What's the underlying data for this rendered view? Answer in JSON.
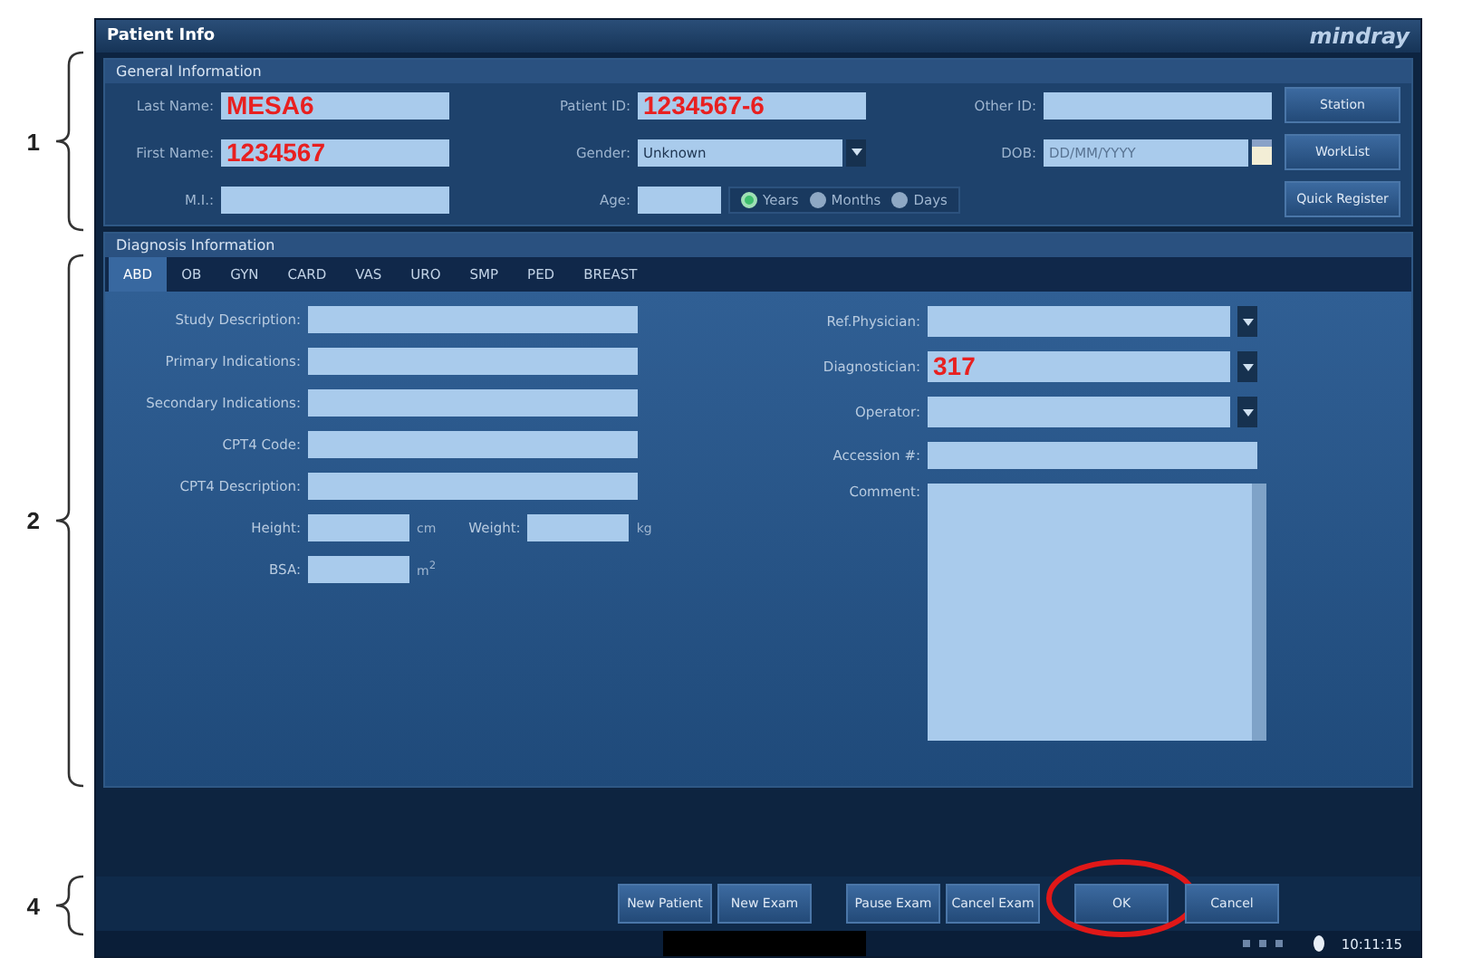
{
  "window": {
    "title": "Patient Info",
    "logo": "mindray"
  },
  "callouts": [
    {
      "label": "1",
      "kind": "general"
    },
    {
      "label": "2",
      "kind": "diagnosis"
    },
    {
      "label": "4",
      "kind": "bottom"
    }
  ],
  "general": {
    "heading": "General Information",
    "rows": [
      [
        {
          "label": "Last Name:",
          "kind": "text",
          "value": "MESA6",
          "overlay": true
        },
        {
          "label": "Patient ID:",
          "kind": "text",
          "value": "1234567-6",
          "overlay": true
        },
        {
          "label": "Other ID:",
          "kind": "text"
        }
      ],
      [
        {
          "label": "First Name:",
          "kind": "text",
          "value": "1234567",
          "overlay": true
        },
        {
          "label": "Gender:",
          "kind": "select",
          "value": "Unknown",
          "overlay": false
        },
        {
          "label": "DOB:",
          "kind": "date",
          "placeholder": "DD/MM/YYYY"
        }
      ],
      [
        {
          "label": "M.I.:",
          "kind": "text"
        },
        {
          "label": "Age:",
          "kind": "age"
        }
      ]
    ],
    "age_units": [
      {
        "label": "Years",
        "selected": true
      },
      {
        "label": "Months",
        "selected": false
      },
      {
        "label": "Days",
        "selected": false
      }
    ],
    "buttons": [
      "Station",
      "WorkList",
      "Quick Register"
    ]
  },
  "diagnosis": {
    "heading": "Diagnosis Information",
    "tabs": [
      {
        "label": "ABD",
        "selected": true
      },
      {
        "label": "OB",
        "selected": false
      },
      {
        "label": "GYN",
        "selected": false
      },
      {
        "label": "CARD",
        "selected": false
      },
      {
        "label": "VAS",
        "selected": false
      },
      {
        "label": "URO",
        "selected": false
      },
      {
        "label": "SMP",
        "selected": false
      },
      {
        "label": "PED",
        "selected": false
      },
      {
        "label": "BREAST",
        "selected": false
      }
    ],
    "left": [
      {
        "kind": "text",
        "label": "Study Description:"
      },
      {
        "kind": "text",
        "label": "Primary Indications:"
      },
      {
        "kind": "text",
        "label": "Secondary Indications:"
      },
      {
        "kind": "text",
        "label": "CPT4 Code:"
      },
      {
        "kind": "text",
        "label": "CPT4 Description:"
      },
      {
        "kind": "measure",
        "items": [
          {
            "label": "Height:",
            "unit": "cm"
          },
          {
            "label": "Weight:",
            "unit": "kg"
          }
        ]
      },
      {
        "kind": "measure",
        "items": [
          {
            "label": "BSA:",
            "unit": "m$^{2}$"
          }
        ]
      }
    ],
    "right": [
      {
        "kind": "select",
        "label": "Ref.Physician:"
      },
      {
        "kind": "select",
        "label": "Diagnostician:",
        "value": "317",
        "overlay": true
      },
      {
        "kind": "select",
        "label": "Operator:"
      },
      {
        "kind": "text",
        "label": "Accession #:"
      },
      {
        "kind": "textarea",
        "label": "Comment:"
      }
    ]
  },
  "bottom_buttons": [
    {
      "label": "New Patient",
      "highlighted": false
    },
    {
      "label": "New Exam",
      "highlighted": false
    },
    {
      "label": "Pause Exam",
      "highlighted": false
    },
    {
      "label": "Cancel Exam",
      "highlighted": false
    },
    {
      "label": "OK",
      "highlighted": true
    },
    {
      "label": "Cancel",
      "highlighted": false
    }
  ],
  "status_bar": {
    "time": "10:11:15"
  }
}
